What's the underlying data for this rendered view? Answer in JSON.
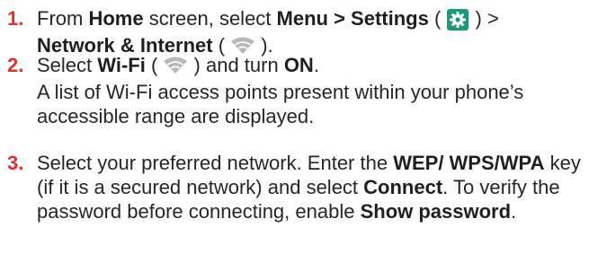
{
  "steps": [
    {
      "number": "1.",
      "line1_a": "From ",
      "line1_b": "Home",
      "line1_c": " screen, select ",
      "line1_d": "Menu > Settings",
      "line1_e": " (",
      "line1_f": ") >",
      "line2_a": "Network & Internet",
      "line2_b": " (",
      "line2_c": ")."
    },
    {
      "number": "2.",
      "a": "Select ",
      "b": "Wi-Fi",
      "c": " (",
      "d": ") and turn ",
      "e": "ON",
      "f": ".",
      "para2": "A list of Wi-Fi access points present within your phone’s accessible range are displayed."
    },
    {
      "number": "3.",
      "a": "Select your preferred network. Enter the ",
      "b": "WEP/ WPS/WPA",
      "c": " key (if it is a secured network) and select ",
      "d": "Connect",
      "e": ". To verify the password before connecting, enable ",
      "f": "Show password",
      "g": "."
    }
  ],
  "icons": {
    "settings": "settings-gear-icon",
    "wifi": "wifi-icon"
  },
  "colors": {
    "step_number": "#e0312e",
    "text": "#262626",
    "settings_icon_bg": "#1b9a7a",
    "wifi_icon": "#b8b8b8"
  }
}
